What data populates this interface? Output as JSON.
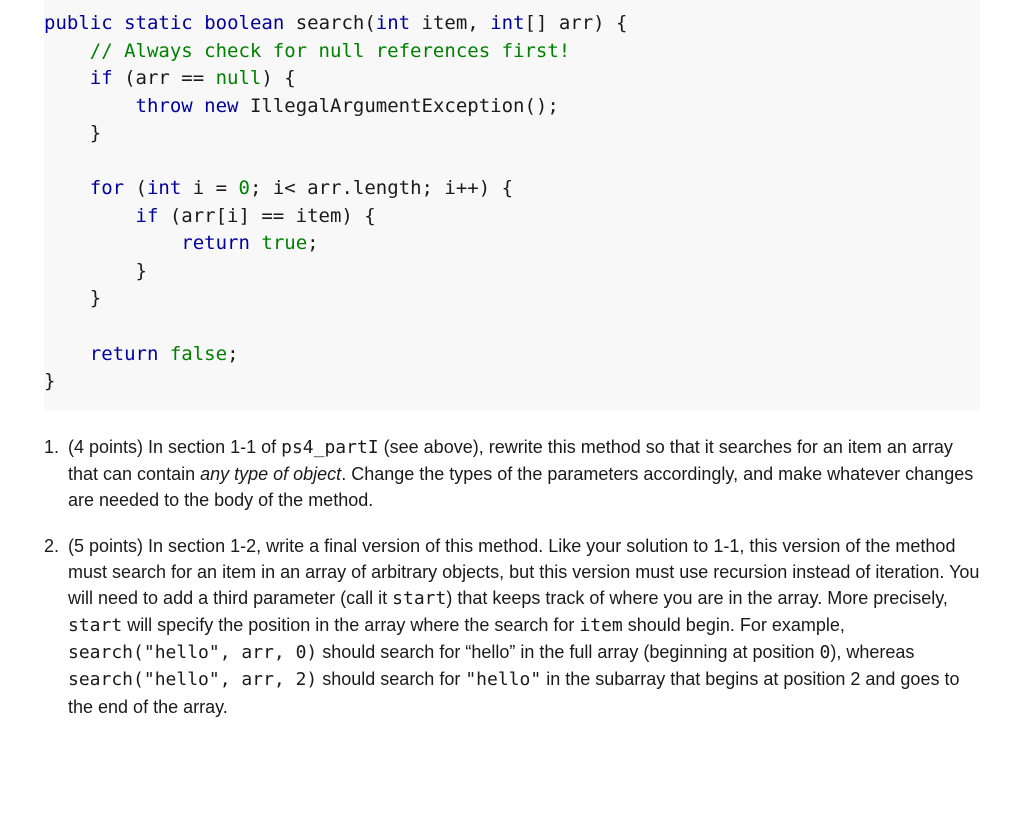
{
  "code": {
    "l01a": "public",
    "l01b": "static",
    "l01c": "boolean",
    "l01d": " search(",
    "l01e": "int",
    "l01f": " item, ",
    "l01g": "int",
    "l01h": "[] arr) {",
    "l02": "// Always check for null references first!",
    "l03a": "if",
    "l03b": " (arr == ",
    "l03c": "null",
    "l03d": ") {",
    "l04a": "throw",
    "l04b": "new",
    "l04c": " IllegalArgumentException();",
    "l05": "}",
    "l06a": "for",
    "l06b": " (",
    "l06c": "int",
    "l06d": " i = ",
    "l06e": "0",
    "l06f": "; i< arr.length; i++) {",
    "l07a": "if",
    "l07b": " (arr[i] == item) {",
    "l08a": "return",
    "l08b": "true",
    "l08c": ";",
    "l09": "}",
    "l10": "}",
    "l11a": "return",
    "l11b": "false",
    "l11c": ";",
    "l12": "}"
  },
  "q1": {
    "num": "1.",
    "t1": "(4 points) In section 1-1 of ",
    "file": "ps4_partI",
    "t2": " (see above), rewrite this method so that it searches for an item an array that can contain ",
    "ital": "any type of object",
    "t3": ". Change the types of the parameters accordingly, and make whatever changes are needed to the body of the method."
  },
  "q2": {
    "num": "2.",
    "t1": "(5 points) In section 1-2, write a final version of this method. Like your solution to 1-1, this version of the method must search for an item in an array of arbitrary objects, but this version must use recursion instead of iteration. You will need to add a third parameter (call it ",
    "m_start": "start",
    "t2": ") that keeps track of where you are in the array. More precisely, ",
    "m_start2": "start",
    "t3": " will specify the position in the array where the search for ",
    "m_item": "item",
    "t4": " should begin. For example, ",
    "m_call1": "search(\"hello\", arr, 0)",
    "t5": " should search for “hello” in the full array (beginning at position ",
    "m_zero": "0",
    "t6": "), whereas ",
    "m_call2": "search(\"hello\", arr, 2)",
    "t7": " should search for ",
    "m_hello": "\"hello\"",
    "t8": " in the subarray that begins at position 2 and goes to the end of the array."
  }
}
